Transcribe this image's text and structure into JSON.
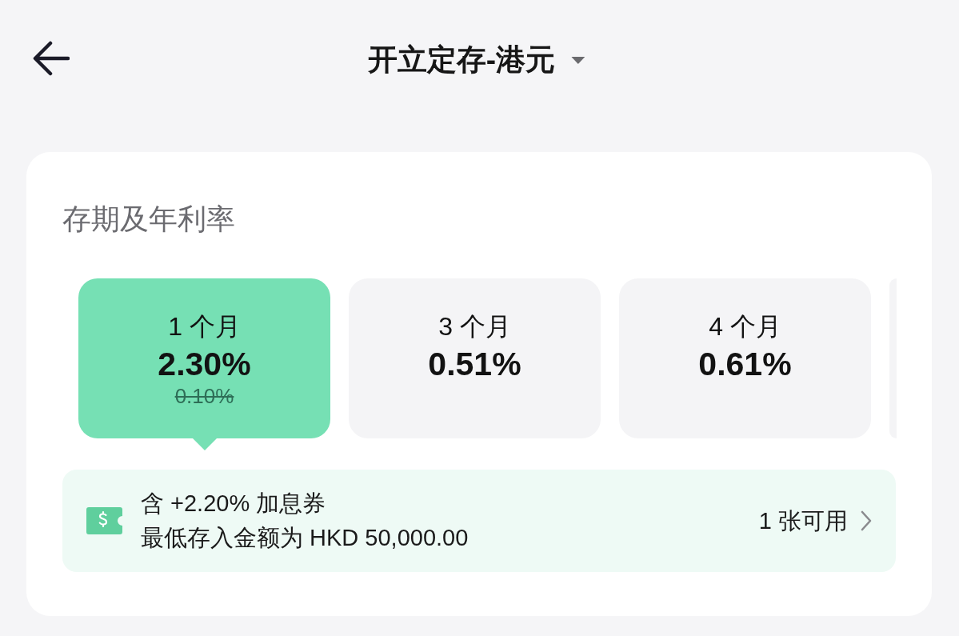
{
  "header": {
    "title": "开立定存-港元"
  },
  "section": {
    "title": "存期及年利率"
  },
  "terms": [
    {
      "label": "1 个月",
      "rate": "2.30%",
      "original_rate": "0.10%",
      "selected": true
    },
    {
      "label": "3 个月",
      "rate": "0.51%",
      "selected": false
    },
    {
      "label": "4 个月",
      "rate": "0.61%",
      "selected": false
    }
  ],
  "coupon": {
    "title": "含 +2.20% 加息券",
    "minimum": "最低存入金额为 HKD 50,000.00",
    "available": "1 张可用"
  }
}
